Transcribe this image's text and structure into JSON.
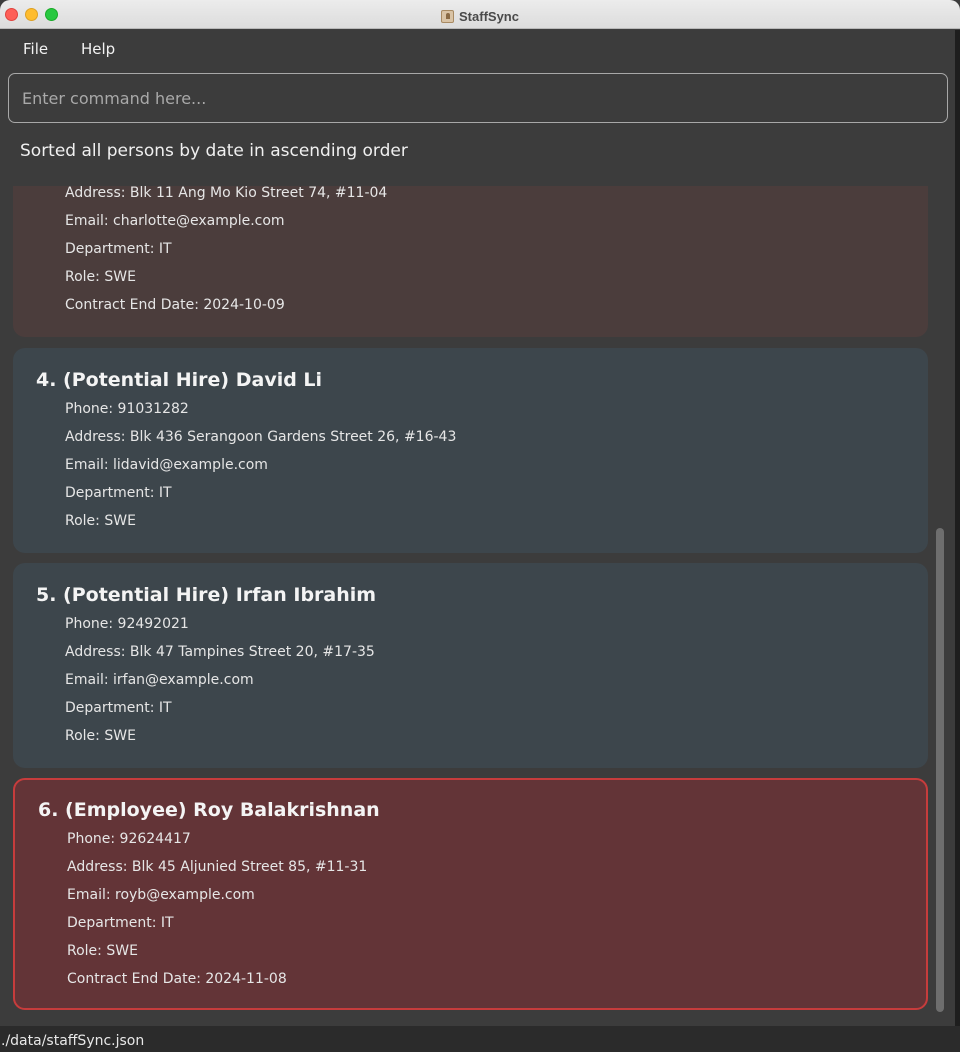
{
  "window": {
    "title": "StaffSync"
  },
  "menu": {
    "file": "File",
    "help": "Help"
  },
  "command": {
    "placeholder": "Enter command here..."
  },
  "result": "Sorted all persons by date in ascending order",
  "persons": [
    {
      "address": "Address: Blk 11 Ang Mo Kio Street 74, #11-04",
      "email": "Email: charlotte@example.com",
      "department": "Department: IT",
      "role": "Role: SWE",
      "contract": "Contract End Date: 2024-10-09"
    },
    {
      "name": "4. (Potential Hire) David Li",
      "phone": "Phone: 91031282",
      "address": "Address: Blk 436 Serangoon Gardens Street 26, #16-43",
      "email": "Email: lidavid@example.com",
      "department": "Department: IT",
      "role": "Role: SWE"
    },
    {
      "name": "5. (Potential Hire) Irfan Ibrahim",
      "phone": "Phone: 92492021",
      "address": "Address: Blk 47 Tampines Street 20, #17-35",
      "email": "Email: irfan@example.com",
      "department": "Department: IT",
      "role": "Role: SWE"
    },
    {
      "name": "6. (Employee) Roy Balakrishnan",
      "phone": "Phone: 92624417",
      "address": "Address: Blk 45 Aljunied Street 85, #11-31",
      "email": "Email: royb@example.com",
      "department": "Department: IT",
      "role": "Role: SWE",
      "contract": "Contract End Date: 2024-11-08"
    }
  ],
  "status": {
    "file_path": "./data/staffSync.json"
  },
  "colors": {
    "background": "#3c3c3c",
    "card": "#3d464c",
    "card_employee": "#4b3d3c",
    "card_selected": "#633437",
    "selected_border": "#c73c3c"
  }
}
